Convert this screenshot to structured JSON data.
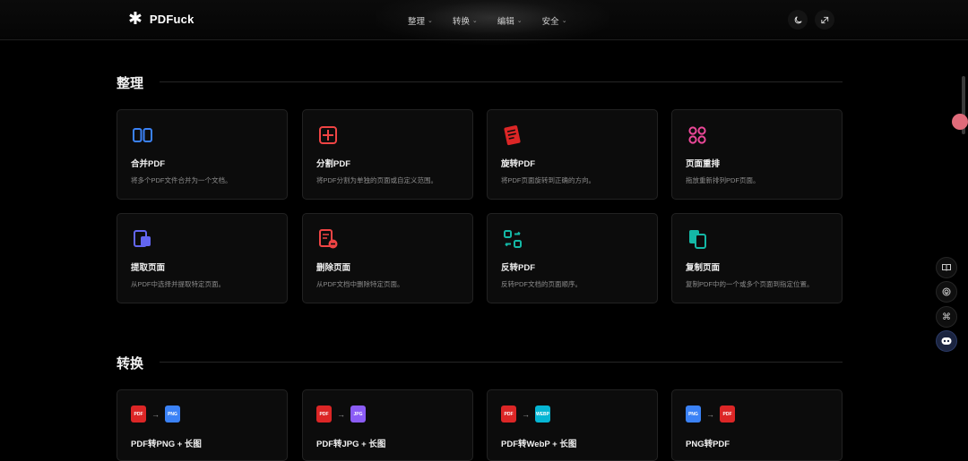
{
  "header": {
    "logo_icon": "asterisk-icon",
    "app_name": "PDFuck",
    "menu": [
      {
        "label": "整理"
      },
      {
        "label": "转换"
      },
      {
        "label": "编辑"
      },
      {
        "label": "安全"
      }
    ],
    "theme_toggle_icon": "moon-icon",
    "translate_icon": "translate-icon"
  },
  "sections": [
    {
      "title": "整理",
      "cards": [
        {
          "title": "合并PDF",
          "desc": "将多个PDF文件合并为一个文档。",
          "icon": "merge-icon",
          "color": "#3b82f6"
        },
        {
          "title": "分割PDF",
          "desc": "将PDF分割为单独的页面或自定义范围。",
          "icon": "split-icon",
          "color": "#ef4444"
        },
        {
          "title": "旋转PDF",
          "desc": "将PDF页面旋转到正确的方向。",
          "icon": "rotate-icon",
          "color": "#dc2626"
        },
        {
          "title": "页面重排",
          "desc": "拖放重新排列PDF页面。",
          "icon": "reorder-icon",
          "color": "#ec4899"
        },
        {
          "title": "提取页面",
          "desc": "从PDF中选择并提取特定页面。",
          "icon": "extract-icon",
          "color": "#6366f1"
        },
        {
          "title": "删除页面",
          "desc": "从PDF文档中删除特定页面。",
          "icon": "delete-pages-icon",
          "color": "#ef4444"
        },
        {
          "title": "反转PDF",
          "desc": "反转PDF文档的页面顺序。",
          "icon": "reverse-icon",
          "color": "#14b8a6"
        },
        {
          "title": "复制页面",
          "desc": "复制PDF中的一个或多个页面到指定位置。",
          "icon": "duplicate-icon",
          "color": "#14b8a6"
        }
      ]
    },
    {
      "title": "转换",
      "cards": [
        {
          "title": "PDF转PNG + 长图",
          "from_icon": "pdf-file-icon",
          "to_icon": "png-file-icon",
          "from_color": "#dc2626",
          "to_color": "#3b82f6"
        },
        {
          "title": "PDF转JPG + 长图",
          "from_icon": "pdf-file-icon",
          "to_icon": "jpg-file-icon",
          "from_color": "#dc2626",
          "to_color": "#8b5cf6"
        },
        {
          "title": "PDF转WebP + 长图",
          "from_icon": "pdf-file-icon",
          "to_icon": "webp-file-icon",
          "from_color": "#dc2626",
          "to_color": "#06b6d4"
        },
        {
          "title": "PNG转PDF",
          "from_icon": "png-file-icon",
          "to_icon": "pdf-file-icon",
          "from_color": "#3b82f6",
          "to_color": "#dc2626"
        }
      ]
    }
  ],
  "file_badges": {
    "pdf": "PDF",
    "png": "PNG",
    "jpg": "JPG",
    "webp": "WEBP"
  },
  "sidebar_tools": [
    {
      "icon": "book-icon"
    },
    {
      "icon": "fingerprint-icon"
    },
    {
      "icon": "command-icon"
    },
    {
      "icon": "robot-icon"
    }
  ]
}
